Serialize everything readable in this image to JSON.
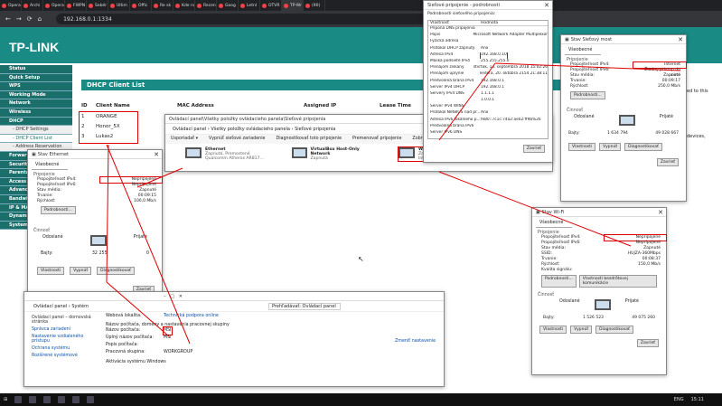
{
  "browser": {
    "tabs": [
      "Opera",
      "Archi",
      "Opera",
      "FWPN Sk",
      "Sebér",
      "Ultim",
      "Offic",
      "Re sk",
      "Kde najde",
      "Recen",
      "Goog",
      "Letnl",
      "OTVR",
      "TP-Wr",
      "(90)"
    ],
    "url": "192.168.0.1:1334"
  },
  "tplink": {
    "logo": "TP-LINK",
    "menu": [
      "Status",
      "Quick Setup",
      "WPS",
      "Working Mode",
      "Network",
      "Wireless",
      "DHCP",
      "- DHCP Settings",
      "- DHCP Client List",
      "- Address Reservation",
      "Forwarding",
      "Security",
      "Parental Control",
      "Access Control",
      "Advanced Routing",
      "Bandwidth Control",
      "IP & MAC Binding",
      "Dynamic DNS",
      "System Tools"
    ],
    "dhcp_title": "DHCP Client List",
    "columns": [
      "ID",
      "Client Name",
      "MAC Address",
      "Assigned IP",
      "Lease Time"
    ],
    "rows": [
      {
        "id": "1",
        "name": "ORANGE"
      },
      {
        "id": "2",
        "name": "Honor_5X"
      },
      {
        "id": "3",
        "name": "Lukas2"
      }
    ],
    "side_text": [
      "ed to this",
      "devices,"
    ]
  },
  "net_connections": {
    "title": "Ovládací panel\\Všetky položky ovládacieho panela\\Sieťové pripojenia",
    "breadcrumb": "Ovládací panel  ›  Všetky položky ovládacieho panela  ›  Sieťové pripojenia",
    "toolbar": [
      "Usporiadať ▾",
      "Vypnúť sieťové zariadenie",
      "Diagnostikovať toto pripojenie",
      "Premenovať pripojenie",
      "Zobraziť sta"
    ],
    "adapters": [
      {
        "name": "Ethernet",
        "status": "Zapnutá, Premostené",
        "device": "Qualcomm Atheros AR817..."
      },
      {
        "name": "VirtualBox Host-Only Network",
        "status": "Zapnutá",
        "device": ""
      },
      {
        "name": "Wi-Fi",
        "status": "Zapnutá, Premostené",
        "device": "Intel(R) Dual Band Wireless..."
      }
    ]
  },
  "ethernet_status": {
    "title": "Stav Ethernet",
    "tab": "Všeobecné",
    "group": "Pripojenie",
    "rows": [
      {
        "k": "Propojiteľnosť IPv4:",
        "v": "Neprípojené"
      },
      {
        "k": "Propojiteľnosť IPv6:",
        "v": "Neprípojené"
      },
      {
        "k": "Stav média:",
        "v": "Zapnuté"
      },
      {
        "k": "Trvanie:",
        "v": "00:09:15"
      },
      {
        "k": "Rýchlosť:",
        "v": "100,0 Mb/s"
      }
    ],
    "details_btn": "Podrobnosti...",
    "activity": "Činnosť",
    "sent": "Odoslané",
    "received": "Prijaté",
    "bytes_label": "Bajty:",
    "bytes_sent": "32 255",
    "bytes_recv": "0",
    "buttons": [
      "Vlastnosti",
      "Vypnúť",
      "Diagnostikovať"
    ],
    "close": "Zavrieť"
  },
  "bridge_details": {
    "title": "Sieťové pripojenie - podrobnosti",
    "heading": "Podrobnosti sieťového pripojenia:",
    "col_prop": "Vlastnosť",
    "col_val": "Hodnota",
    "rows": [
      {
        "k": "Prípona DNS pripojenia",
        "v": ""
      },
      {
        "k": "Popis",
        "v": "Microsoft Network Adapter Multiplexor"
      },
      {
        "k": "Fyzická adresa",
        "v": ""
      },
      {
        "k": "Protokol DHCP zapnutý",
        "v": "Áno"
      },
      {
        "k": "Adresa IPv4",
        "v": "192.168.0.10"
      },
      {
        "k": "Maska podsiete IPv4",
        "v": "255.255.255.0"
      },
      {
        "k": "Prenájom získaný",
        "v": "štvrtok, 13. septembra 2018 15:02:26"
      },
      {
        "k": "Prenájom uplynie",
        "v": "nedeľa, 20. októbra 2154 21:38:11"
      },
      {
        "k": "Predvolená brána IPv4",
        "v": "192.168.0.1"
      },
      {
        "k": "Server IPv4 DHCP",
        "v": "192.168.0.1"
      },
      {
        "k": "Servery IPv4 DNS",
        "v": "1.1.1.1"
      },
      {
        "k": "",
        "v": "1.0.0.1"
      },
      {
        "k": "Server IPv4 WINS",
        "v": ""
      },
      {
        "k": "Protokol NetBIOS nad pr...",
        "v": "Áno"
      },
      {
        "k": "Adresa IPv6 lokálneho p...",
        "v": "fe80::7c1c:74a2:ae02:ff9b%26"
      },
      {
        "k": "Predvolená brána IPv6",
        "v": ""
      },
      {
        "k": "Server IPv6 DNS",
        "v": ""
      }
    ],
    "close": "Zavrieť"
  },
  "bridge_status": {
    "title": "Stav Sieťový most",
    "tab": "Všeobecné",
    "group": "Pripojenie",
    "rows": [
      {
        "k": "Propojiteľnosť IPv4:",
        "v": "Internet"
      },
      {
        "k": "Propojiteľnosť IPv6:",
        "v": "Žiadny prístup do siete"
      },
      {
        "k": "Stav média:",
        "v": "Zapnuté"
      },
      {
        "k": "Trvanie:",
        "v": "00:09:17"
      },
      {
        "k": "Rýchlosť:",
        "v": "250,0 Mb/s"
      }
    ],
    "details_btn": "Podrobnosti...",
    "activity": "Činnosť",
    "sent": "Odoslané",
    "received": "Prijaté",
    "bytes_label": "Bajty:",
    "bytes_sent": "1 634 794",
    "bytes_recv": "49 028 667",
    "buttons": [
      "Vlastnosti",
      "Vypnúť",
      "Diagnostikovať"
    ],
    "close": "Zavrieť"
  },
  "wifi_status": {
    "title": "Stav Wi-Fi",
    "tab": "Všeobecné",
    "group": "Pripojenie",
    "rows": [
      {
        "k": "Propojiteľnosť IPv4:",
        "v": "Neprípojené"
      },
      {
        "k": "Propojiteľnosť IPv6:",
        "v": "Neprípojené"
      },
      {
        "k": "Stav média:",
        "v": "Zapnuté"
      },
      {
        "k": "SSID:",
        "v": "HUJZA-360Mbps"
      },
      {
        "k": "Trvanie:",
        "v": "00:08:37"
      },
      {
        "k": "Rýchlosť:",
        "v": "150,0 Mb/s"
      },
      {
        "k": "Kvalita signálu:",
        "v": ""
      }
    ],
    "details_btn": "Podrobnosti...",
    "props_btn": "Vlastnosti bezdrôtovej komunikácie",
    "activity": "Činnosť",
    "sent": "Odoslané",
    "received": "Prijaté",
    "bytes_label": "Bajty:",
    "bytes_sent": "1 526 523",
    "bytes_recv": "49 075 260",
    "buttons": [
      "Vlastnosti",
      "Vypnúť",
      "Diagnostikovať"
    ],
    "close": "Zavrieť"
  },
  "system": {
    "breadcrumb": "Ovládací panel  ›  Systém",
    "search": "Prehľadávať: Ovládací panel",
    "left": [
      "Ovládací panel – domovská stránka",
      "Správca zariadení",
      "Nastavenie vzdialeného prístupu",
      "Ochrana systému",
      "Rozšírené systémové"
    ],
    "website_label": "Webová lokalita:",
    "website": "Technická podpora online",
    "section": "Názov počítača, domény a nastavenia pracovnej skupiny",
    "rows": [
      {
        "k": "Názov počítača:",
        "v": "MSI"
      },
      {
        "k": "Úplný názov počítača:",
        "v": "MSI"
      },
      {
        "k": "Popis počítača:",
        "v": ""
      },
      {
        "k": "Pracovná skupina:",
        "v": "WORKGROUP"
      }
    ],
    "change": "Zmeniť nastavenie",
    "activation": "Aktivácia systému Windows"
  },
  "taskbar": {
    "lang": "ENG",
    "time": "15:11"
  },
  "colors": {
    "tplink_teal": "#1a8a85",
    "highlight_red": "#dd0000"
  }
}
